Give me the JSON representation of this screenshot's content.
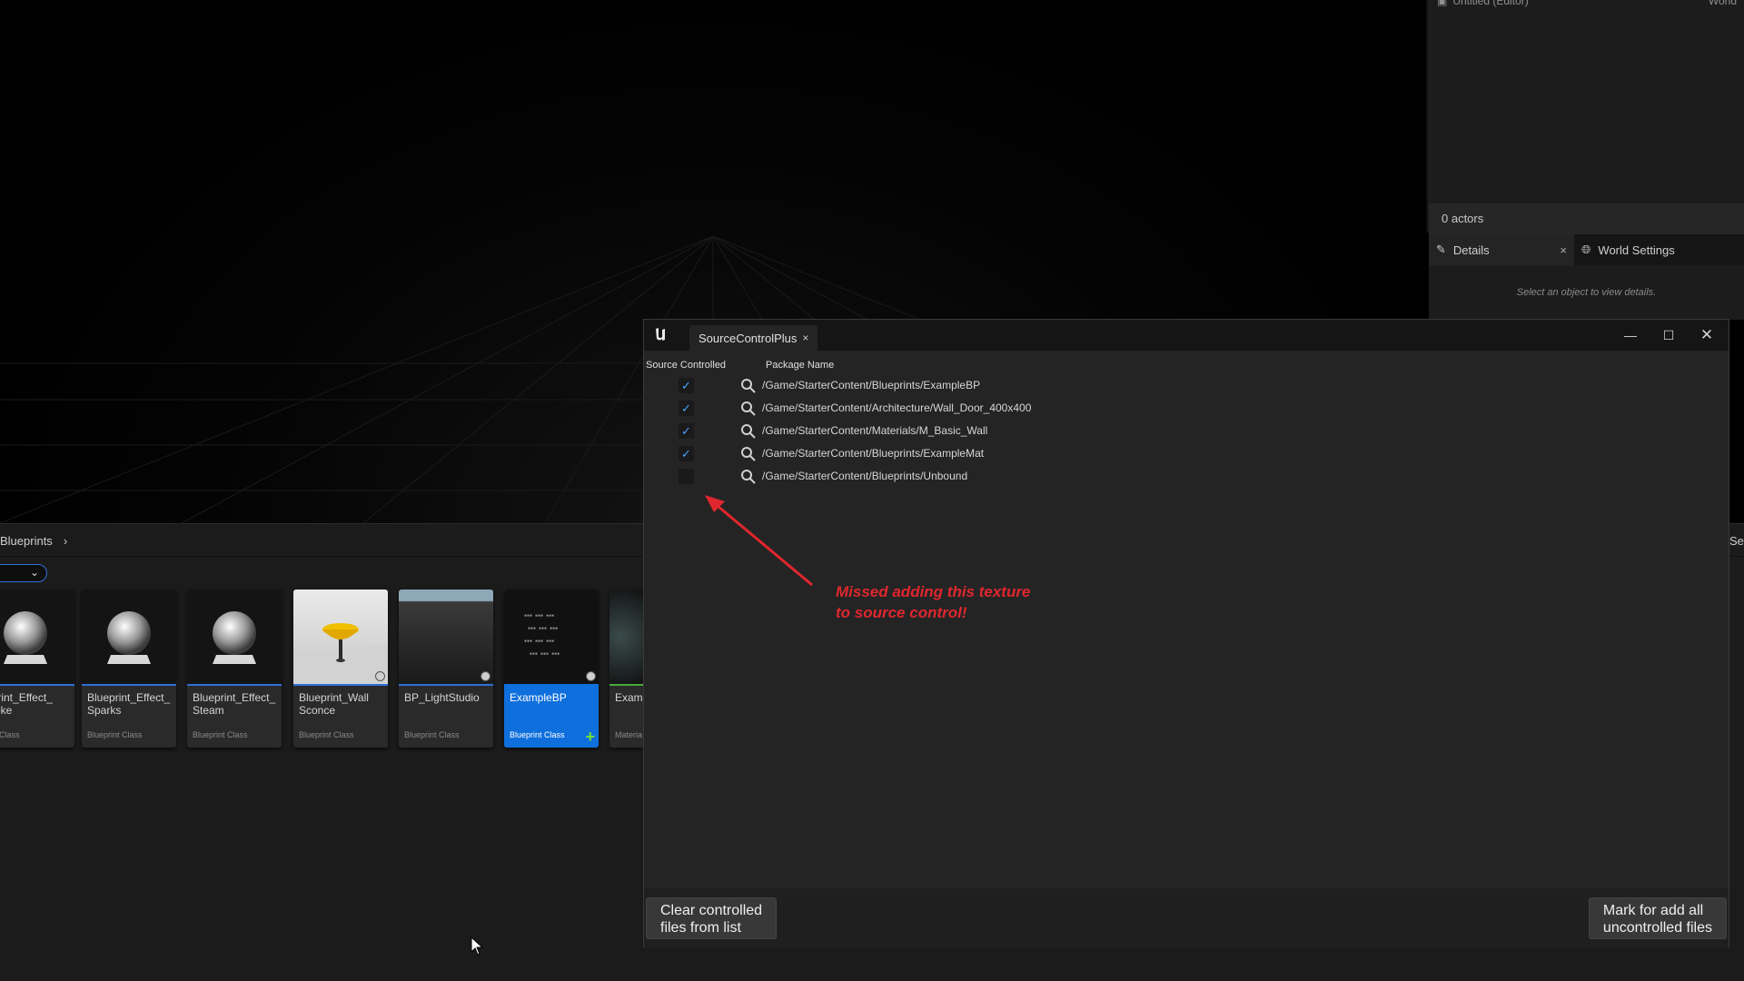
{
  "outliner": {
    "top_row_label": "Untitled (Editor)",
    "top_row_type": "World",
    "actor_count": "0 actors"
  },
  "details": {
    "tab_details": "Details",
    "tab_close": "×",
    "tab_world_settings": "World Settings",
    "hint": "Select an object to view details."
  },
  "content_browser": {
    "breadcrumb": "Blueprints",
    "right_text": "Se",
    "tiles": [
      {
        "name": "Blueprint_Effect_Smoke",
        "display": "eprint_Effect_\nmoke",
        "class": "rint Class"
      },
      {
        "name": "Blueprint_Effect_Sparks",
        "display": "Blueprint_Effect_\nSparks",
        "class": "Blueprint Class"
      },
      {
        "name": "Blueprint_Effect_Steam",
        "display": "Blueprint_Effect_\nSteam",
        "class": "Blueprint Class"
      },
      {
        "name": "Blueprint_WallSconce",
        "display": "Blueprint_Wall\nSconce",
        "class": "Blueprint Class"
      },
      {
        "name": "BP_LightStudio",
        "display": "BP_LightStudio",
        "class": "Blueprint Class"
      },
      {
        "name": "ExampleBP",
        "display": "ExampleBP",
        "class": "Blueprint Class"
      },
      {
        "name": "ExampleMat",
        "display": "Examp",
        "class": "Materia"
      }
    ]
  },
  "scp": {
    "tab_label": "SourceControlPlus",
    "tab_close": "×",
    "col_source_controlled": "Source Controlled",
    "col_package_name": "Package Name",
    "rows": [
      {
        "checked": true,
        "path": "/Game/StarterContent/Blueprints/ExampleBP"
      },
      {
        "checked": true,
        "path": "/Game/StarterContent/Architecture/Wall_Door_400x400"
      },
      {
        "checked": true,
        "path": "/Game/StarterContent/Materials/M_Basic_Wall"
      },
      {
        "checked": true,
        "path": "/Game/StarterContent/Blueprints/ExampleMat"
      },
      {
        "checked": false,
        "path": "/Game/StarterContent/Blueprints/Unbound"
      }
    ],
    "annotation_line1": "Missed adding this texture",
    "annotation_line2": "to source control!",
    "btn_clear_line1": "Clear controlled",
    "btn_clear_line2": "files from list",
    "btn_mark_line1": "Mark for add all",
    "btn_mark_line2": "uncontrolled files"
  },
  "colors": {
    "accent_blue": "#0f6fdc",
    "annotation_red": "#e0262e",
    "check_blue": "#4aa2ff",
    "plus_green": "#6ee03a"
  }
}
